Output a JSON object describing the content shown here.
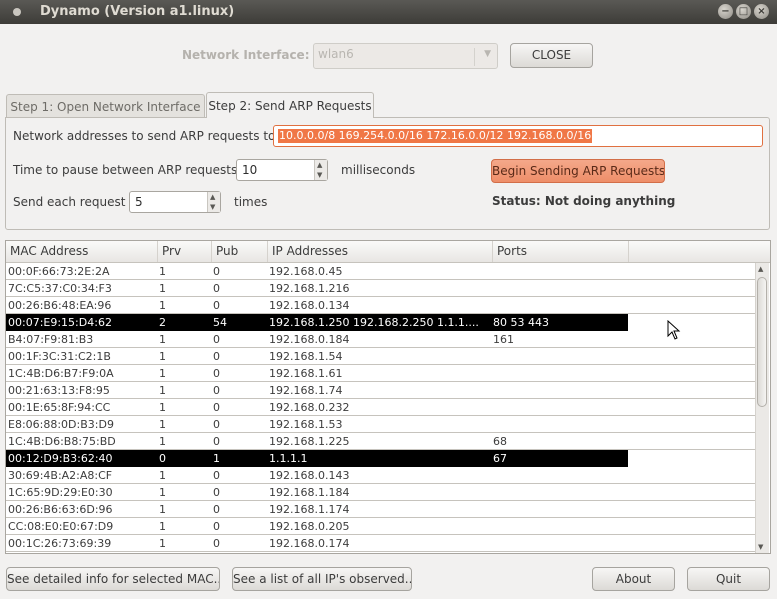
{
  "window": {
    "title": "Dynamo (Version a1.linux)",
    "controls": [
      "−",
      "□",
      "×"
    ]
  },
  "network": {
    "label": "Network Interface:",
    "interface": "wlan6",
    "close_label": "CLOSE"
  },
  "tabs": [
    {
      "label": "Step 1: Open Network Interface"
    },
    {
      "label": "Step 2: Send ARP Requests"
    }
  ],
  "arp": {
    "addresses_label": "Network addresses to send ARP requests to:",
    "addresses_value": "10.0.0.0/8 169.254.0.0/16 172.16.0.0/12 192.168.0.0/16",
    "pause_label": "Time to pause between ARP requests:",
    "pause_value": "10",
    "pause_unit": "milliseconds",
    "send_label": "Send each request",
    "send_value": "5",
    "send_unit": "times",
    "begin_label": "Begin Sending ARP Requests",
    "status": "Status: Not doing anything"
  },
  "table": {
    "columns": [
      "MAC Address",
      "Prv",
      "Pub",
      "IP Addresses",
      "Ports"
    ],
    "rows": [
      {
        "mac": "00:0F:66:73:2E:2A",
        "prv": "1",
        "pub": "0",
        "ip": "192.168.0.45",
        "ports": ""
      },
      {
        "mac": "7C:C5:37:C0:34:F3",
        "prv": "1",
        "pub": "0",
        "ip": "192.168.1.216",
        "ports": ""
      },
      {
        "mac": "00:26:B6:48:EA:96",
        "prv": "1",
        "pub": "0",
        "ip": "192.168.0.134",
        "ports": ""
      },
      {
        "mac": "00:07:E9:15:D4:62",
        "prv": "2",
        "pub": "54",
        "ip": "192.168.1.250  192.168.2.250  1.1.1....",
        "ports": "80  53  443",
        "selected": true
      },
      {
        "mac": "B4:07:F9:81:B3",
        "prv": "1",
        "pub": "0",
        "ip": "192.168.0.184",
        "ports": "161"
      },
      {
        "mac": "00:1F:3C:31:C2:1B",
        "prv": "1",
        "pub": "0",
        "ip": "192.168.1.54",
        "ports": ""
      },
      {
        "mac": "1C:4B:D6:B7:F9:0A",
        "prv": "1",
        "pub": "0",
        "ip": "192.168.1.61",
        "ports": ""
      },
      {
        "mac": "00:21:63:13:F8:95",
        "prv": "1",
        "pub": "0",
        "ip": "192.168.1.74",
        "ports": ""
      },
      {
        "mac": "00:1E:65:8F:94:CC",
        "prv": "1",
        "pub": "0",
        "ip": "192.168.0.232",
        "ports": ""
      },
      {
        "mac": "E8:06:88:0D:B3:D9",
        "prv": "1",
        "pub": "0",
        "ip": "192.168.1.53",
        "ports": ""
      },
      {
        "mac": "1C:4B:D6:B8:75:BD",
        "prv": "1",
        "pub": "0",
        "ip": "192.168.1.225",
        "ports": "68"
      },
      {
        "mac": "00:12:D9:B3:62:40",
        "prv": "0",
        "pub": "1",
        "ip": "1.1.1.1",
        "ports": "67",
        "selected": true
      },
      {
        "mac": "30:69:4B:A2:A8:CF",
        "prv": "1",
        "pub": "0",
        "ip": "192.168.0.143",
        "ports": ""
      },
      {
        "mac": "1C:65:9D:29:E0:30",
        "prv": "1",
        "pub": "0",
        "ip": "192.168.1.184",
        "ports": ""
      },
      {
        "mac": "00:26:B6:63:6D:96",
        "prv": "1",
        "pub": "0",
        "ip": "192.168.1.174",
        "ports": ""
      },
      {
        "mac": "CC:08:E0:E0:67:D9",
        "prv": "1",
        "pub": "0",
        "ip": "192.168.0.205",
        "ports": ""
      },
      {
        "mac": "00:1C:26:73:69:39",
        "prv": "1",
        "pub": "0",
        "ip": "192.168.0.174",
        "ports": ""
      }
    ]
  },
  "footer": {
    "detail_label": "See detailed info for selected MAC...",
    "list_label": "See a list of all IP's observed...",
    "about_label": "About",
    "quit_label": "Quit"
  },
  "colors": {
    "accent": "#f07746",
    "selected_row": "#000000",
    "titlebar": "#3d3c38"
  }
}
